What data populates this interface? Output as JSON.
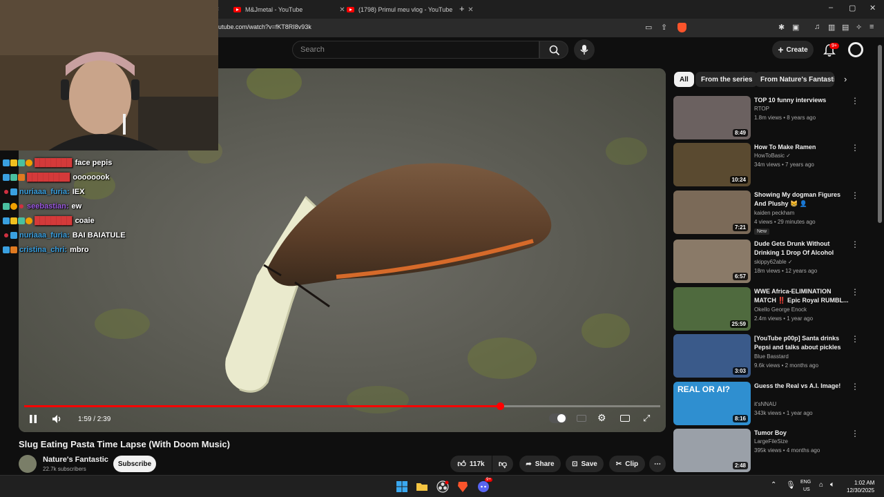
{
  "browser": {
    "tabs": [
      {
        "title": "M&Jmetal - YouTube",
        "icon": "youtube-favicon"
      },
      {
        "title": "(1798) Primul meu vlog - YouTube",
        "icon": "youtube-favicon"
      }
    ],
    "new_tab_label": "+",
    "url": "utube.com/watch?v=fKT8RI8v93k",
    "window_controls": [
      "–",
      "▢",
      "✕"
    ]
  },
  "header": {
    "search_placeholder": "Search",
    "create_label": "Create",
    "notification_count": "9+"
  },
  "video": {
    "title": "Slug Eating Pasta Time Lapse (With Doom Music)",
    "time_display": "1:59 / 2:39",
    "progress_fraction": 0.748
  },
  "channel": {
    "name": "Nature's Fantastic",
    "subscribers": "22.7k subscribers",
    "subscribe_label": "Subscribe"
  },
  "actions": {
    "likes": "117k",
    "share_label": "Share",
    "save_label": "Save",
    "clip_label": "Clip"
  },
  "chat": [
    {
      "user": "███████",
      "message": "face pepis",
      "user_color": "#d43a3a"
    },
    {
      "user": "████████",
      "message": "oooooook",
      "user_color": "#d43a3a"
    },
    {
      "user": "nuriaaa_furia:",
      "message": "IEX",
      "user_color": "#3aa0e0"
    },
    {
      "user": "seebastian:",
      "message": "ew",
      "user_color": "#9b59e0"
    },
    {
      "user": "███████",
      "message": "coaie",
      "user_color": "#d43a3a"
    },
    {
      "user": "nuriaaa_furia:",
      "message": "BAI BAIATULE",
      "user_color": "#3aa0e0"
    },
    {
      "user": "cristina_chri:",
      "message": "mbro",
      "user_color": "#3aa0e0"
    }
  ],
  "sidebar": {
    "chips": [
      "All",
      "From the series",
      "From Nature's Fantastic"
    ],
    "recommendations": [
      {
        "title": "TOP 10 funny interviews",
        "channel": "RTOP",
        "meta": "1.8m views • 8 years ago",
        "duration": "8:49",
        "thumb_color": "#6b6160"
      },
      {
        "title": "How To Make Ramen",
        "channel": "HowToBasic ✓",
        "meta": "34m views • 7 years ago",
        "duration": "10:24",
        "thumb_color": "#5a4a30"
      },
      {
        "title": "Showing My dogman Figures And Plushy 😸 👤",
        "channel": "kaiden peckham",
        "meta": "4 views • 29 minutes ago",
        "duration": "7:21",
        "badge": "New",
        "thumb_color": "#7b6a58"
      },
      {
        "title": "Dude Gets Drunk Without Drinking 1 Drop Of Alcohol",
        "channel": "skippy62able ✓",
        "meta": "18m views • 12 years ago",
        "duration": "6:57",
        "thumb_color": "#8a7a68"
      },
      {
        "title": "WWE  Africa-ELIMINATION MATCH ‼️ Epic Royal RUMBL...",
        "channel": "Okello George Enock",
        "meta": "2.4m views • 1 year ago",
        "duration": "25:59",
        "thumb_color": "#4f6a3e"
      },
      {
        "title": "[YouTube p00p] Santa drinks Pepsi and talks about pickles",
        "channel": "Blue Basstard",
        "meta": "9.6k views • 2 months ago",
        "duration": "3:03",
        "thumb_color": "#3a5a8a"
      },
      {
        "title": "Guess the Real vs A.I. Image!",
        "channel": "it'sNNAU",
        "meta": "343k views • 1 year ago",
        "duration": "8:16",
        "thumb_color": "#2f8fd0",
        "thumb_text": "REAL OR AI?"
      },
      {
        "title": "Tumor Boy",
        "channel": "LargeFileSize",
        "meta": "395k views • 4 months ago",
        "duration": "2:48",
        "thumb_color": "#9aa0a8"
      }
    ]
  },
  "taskbar": {
    "language_line1": "ENG",
    "language_line2": "US",
    "time": "1:02 AM",
    "date": "12/30/2025",
    "discord_badge": "9+"
  }
}
